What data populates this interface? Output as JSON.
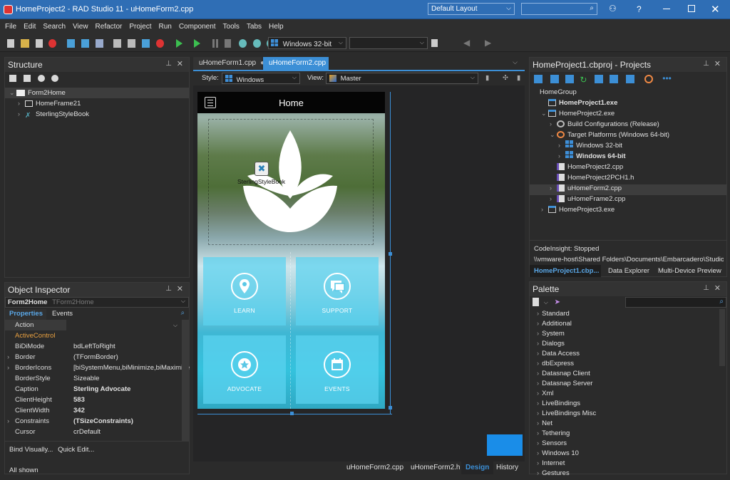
{
  "window": {
    "title": "HomeProject2 - RAD Studio 11 - uHomeForm2.cpp",
    "layout": "Default Layout"
  },
  "menu": [
    "File",
    "Edit",
    "Search",
    "View",
    "Refactor",
    "Project",
    "Run",
    "Component",
    "Tools",
    "Tabs",
    "Help"
  ],
  "toolbar": {
    "platform": "Windows 32-bit"
  },
  "structure": {
    "title": "Structure",
    "items": [
      {
        "label": "Form2Home"
      },
      {
        "label": "HomeFrame21"
      },
      {
        "label": "SterlingStyleBook"
      }
    ]
  },
  "object_inspector": {
    "title": "Object Inspector",
    "component": "Form2Home",
    "component_type": "TForm2Home",
    "tab_properties": "Properties",
    "tab_events": "Events",
    "rows": [
      {
        "k": "Action",
        "v": ""
      },
      {
        "k": "ActiveControl",
        "v": ""
      },
      {
        "k": "BiDiMode",
        "v": "bdLeftToRight"
      },
      {
        "k": "Border",
        "v": "(TFormBorder)"
      },
      {
        "k": "BorderIcons",
        "v": "[biSystemMenu,biMinimize,biMaximize"
      },
      {
        "k": "BorderStyle",
        "v": "Sizeable"
      },
      {
        "k": "Caption",
        "v": "Sterling Advocate"
      },
      {
        "k": "ClientHeight",
        "v": "583"
      },
      {
        "k": "ClientWidth",
        "v": "342"
      },
      {
        "k": "Constraints",
        "v": "(TSizeConstraints)"
      },
      {
        "k": "Cursor",
        "v": "crDefault"
      }
    ],
    "bind_visually": "Bind Visually...",
    "quick_edit": "Quick Edit...",
    "all_shown": "All shown"
  },
  "editor": {
    "tabs": [
      {
        "label": "uHomeForm1.cpp"
      },
      {
        "label": "uHomeForm2.cpp"
      }
    ],
    "style_label": "Style:",
    "style_value": "Windows",
    "view_label": "View:",
    "view_value": "Master",
    "bottom_tabs": [
      "uHomeForm2.cpp",
      "uHomeForm2.h",
      "Design",
      "History"
    ]
  },
  "form": {
    "title": "Home",
    "stylebook_label": "SterlingStyleBook",
    "tiles": [
      "LEARN",
      "SUPPORT",
      "ADVOCATE",
      "EVENTS"
    ]
  },
  "projects": {
    "title": "HomeProject1.cbproj - Projects",
    "tree": [
      {
        "label": "HomeGroup"
      },
      {
        "label": "HomeProject1.exe"
      },
      {
        "label": "HomeProject2.exe"
      },
      {
        "label": "Build Configurations (Release)"
      },
      {
        "label": "Target Platforms (Windows 64-bit)"
      },
      {
        "label": "Windows 32-bit"
      },
      {
        "label": "Windows 64-bit"
      },
      {
        "label": "HomeProject2.cpp"
      },
      {
        "label": "HomeProject2PCH1.h"
      },
      {
        "label": "uHomeForm2.cpp"
      },
      {
        "label": "uHomeFrame2.cpp"
      },
      {
        "label": "HomeProject3.exe"
      }
    ],
    "status": "CodeInsight: Stopped",
    "path": "\\\\vmware-host\\Shared Folders\\Documents\\Embarcadero\\Studio...",
    "tabs": [
      "HomeProject1.cbp...",
      "Data Explorer",
      "Multi-Device Preview"
    ]
  },
  "palette": {
    "title": "Palette",
    "items": [
      "Standard",
      "Additional",
      "System",
      "Dialogs",
      "Data Access",
      "dbExpress",
      "Datasnap Client",
      "Datasnap Server",
      "Xml",
      "LiveBindings",
      "LiveBindings Misc",
      "Net",
      "Tethering",
      "Sensors",
      "Windows 10",
      "Internet",
      "Gestures"
    ]
  },
  "colors": {
    "titlebar": "#2f6eb5",
    "accent": "#3c8fd6",
    "tile": "#5cd2f0"
  },
  "icons": [
    "rad-studio-logo",
    "search-icon",
    "user-icon",
    "help-icon",
    "minimize-icon",
    "maximize-icon",
    "close-icon",
    "pin-icon",
    "hamburger-icon",
    "location-pin-icon",
    "chat-icon",
    "star-icon",
    "calendar-icon",
    "lotus-logo"
  ]
}
